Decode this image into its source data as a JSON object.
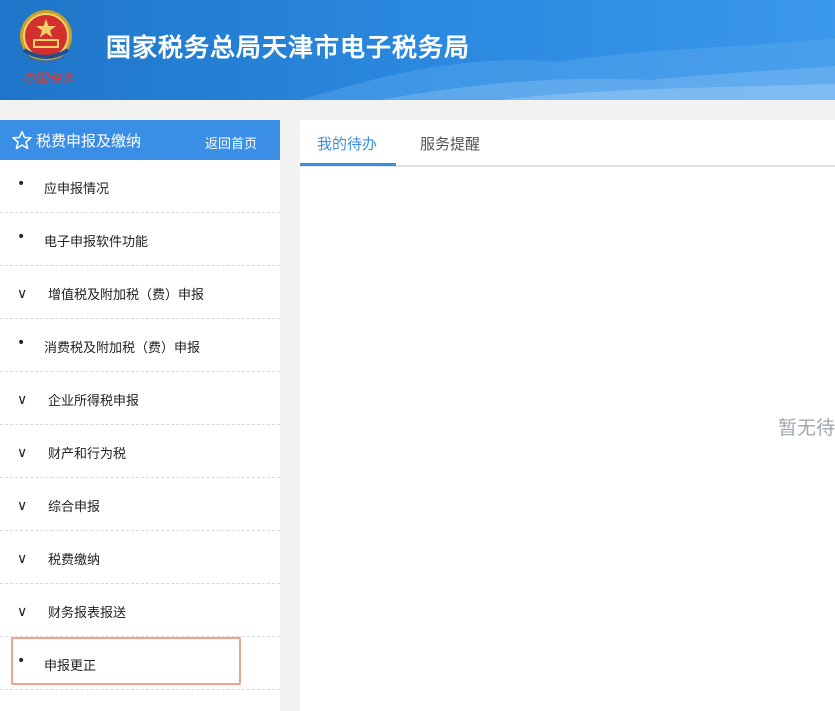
{
  "header": {
    "site_title": "国家税务总局天津市电子税务局",
    "logo_icon": "tax-bureau-emblem-icon",
    "logo_caption": "中国税务"
  },
  "sidebar": {
    "title": "税费申报及缴纳",
    "back_label": "返回首页",
    "star_icon": "star-icon",
    "items": [
      {
        "label": "应申报情况",
        "marker": "•",
        "type": "bullet"
      },
      {
        "label": "电子申报软件功能",
        "marker": "•",
        "type": "bullet"
      },
      {
        "label": "增值税及附加税（费）申报",
        "marker": "∨",
        "type": "expand"
      },
      {
        "label": "消费税及附加税（费）申报",
        "marker": "•",
        "type": "bullet"
      },
      {
        "label": "企业所得税申报",
        "marker": "∨",
        "type": "expand"
      },
      {
        "label": "财产和行为税",
        "marker": "∨",
        "type": "expand"
      },
      {
        "label": "综合申报",
        "marker": "∨",
        "type": "expand"
      },
      {
        "label": "税费缴纳",
        "marker": "∨",
        "type": "expand"
      },
      {
        "label": "财务报表报送",
        "marker": "∨",
        "type": "expand"
      },
      {
        "label": "申报更正",
        "marker": "•",
        "type": "bullet"
      }
    ]
  },
  "main": {
    "tabs": [
      {
        "label": "我的待办",
        "active": true
      },
      {
        "label": "服务提醒",
        "active": false
      }
    ],
    "empty_text": "暂无待"
  },
  "colors": {
    "accent": "#3a8ee6",
    "header_bg": "#2b8ae0",
    "highlight_border": "#f0a090"
  }
}
